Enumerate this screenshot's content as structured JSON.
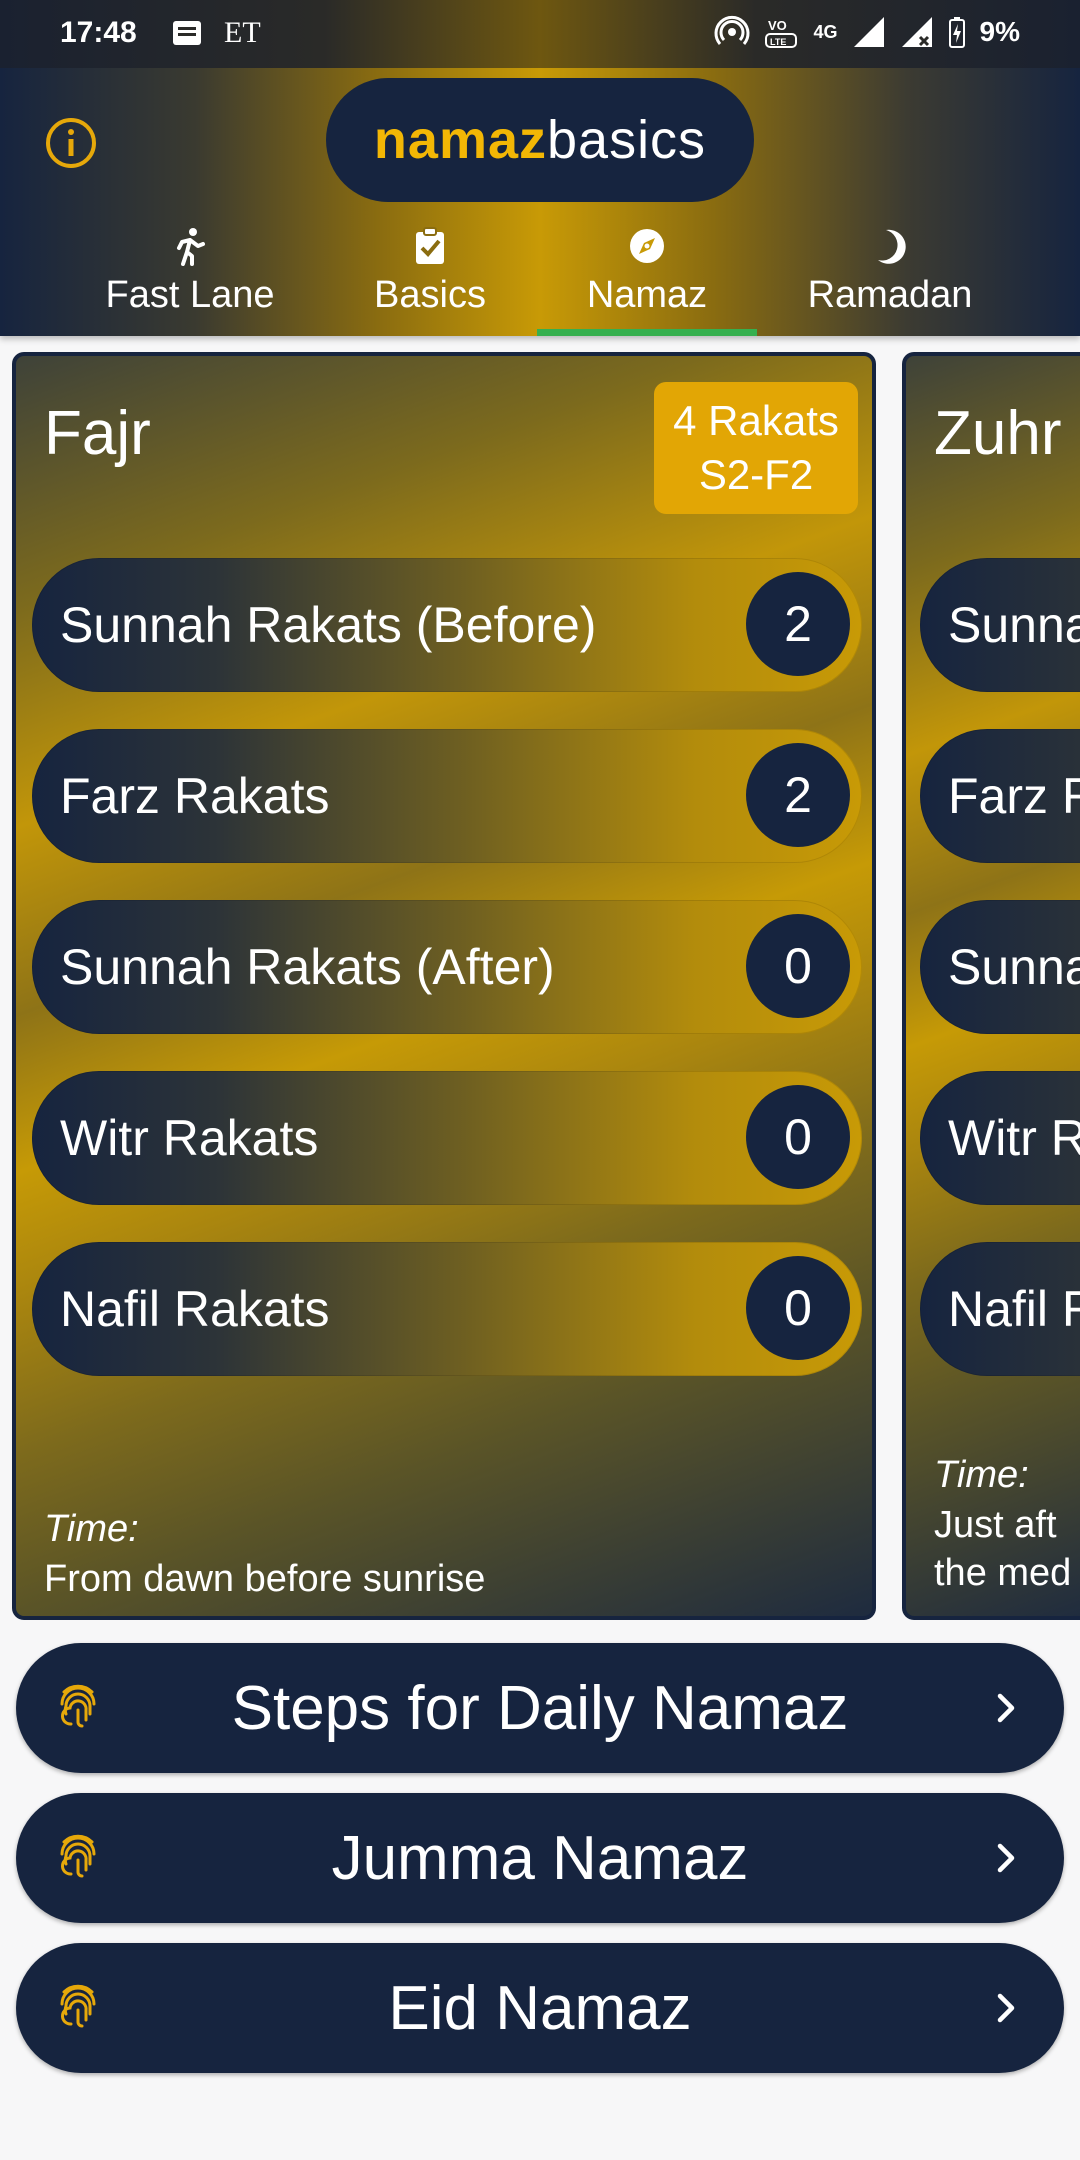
{
  "status_bar": {
    "time": "17:48",
    "carrier": "ET",
    "network": "4G",
    "battery": "9%"
  },
  "header": {
    "logo_part1": "namaz",
    "logo_part2": "basics",
    "tabs": [
      {
        "label": "Fast Lane",
        "icon": "run-icon"
      },
      {
        "label": "Basics",
        "icon": "clipboard-check-icon"
      },
      {
        "label": "Namaz",
        "icon": "compass-icon",
        "selected": true
      },
      {
        "label": "Ramadan",
        "icon": "crescent-moon-icon"
      }
    ],
    "accent_color": "#36b04f",
    "brand_gold": "#f3b705",
    "brand_navy": "#16243f"
  },
  "cards": [
    {
      "title": "Fajr",
      "badge_line1": "4 Rakats",
      "badge_line2": "S2-F2",
      "rows": [
        {
          "label": "Sunnah Rakats (Before)",
          "count": "2"
        },
        {
          "label": "Farz Rakats",
          "count": "2"
        },
        {
          "label": "Sunnah Rakats (After)",
          "count": "0"
        },
        {
          "label": "Witr Rakats",
          "count": "0"
        },
        {
          "label": "Nafil Rakats",
          "count": "0"
        }
      ],
      "time_label": "Time:",
      "time_value": "From dawn before sunrise"
    },
    {
      "title": "Zuhr",
      "rows": [
        {
          "label": "Sunna"
        },
        {
          "label": "Farz R"
        },
        {
          "label": "Sunna"
        },
        {
          "label": "Witr R"
        },
        {
          "label": "Nafil R"
        }
      ],
      "time_label": "Time:",
      "time_line1": "Just aft",
      "time_line2": "the med"
    }
  ],
  "buttons": [
    {
      "label": "Steps for Daily Namaz",
      "icon": "fingerprint-icon"
    },
    {
      "label": "Jumma Namaz",
      "icon": "fingerprint-icon"
    },
    {
      "label": "Eid Namaz",
      "icon": "fingerprint-icon"
    }
  ]
}
